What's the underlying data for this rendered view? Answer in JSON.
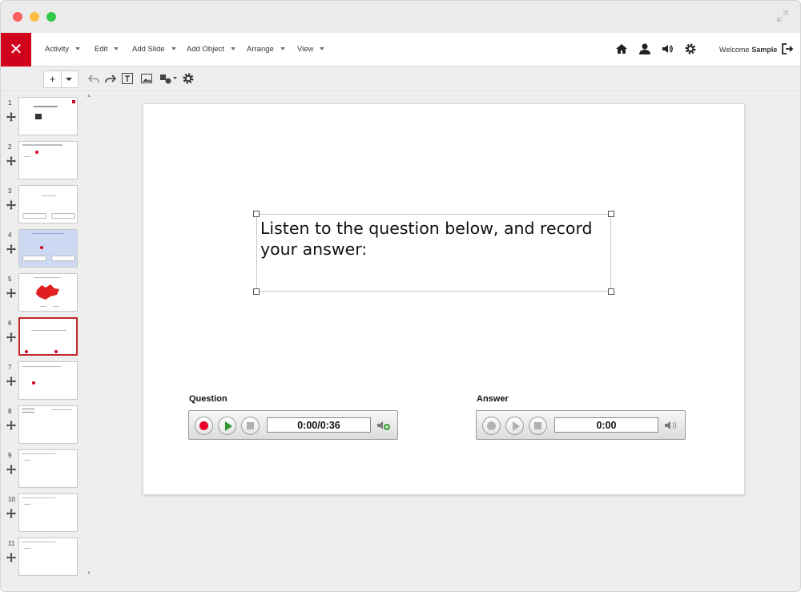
{
  "menubar": {
    "close_glyph": "✕",
    "items": [
      {
        "label": "Activity"
      },
      {
        "label": "Edit"
      },
      {
        "label": "Add Slide"
      },
      {
        "label": "Add Object"
      },
      {
        "label": "Arrange"
      },
      {
        "label": "View"
      }
    ],
    "welcome_prefix": "Welcome",
    "welcome_user": "Sample"
  },
  "toolbar": {
    "add_glyph": "+"
  },
  "slides": [
    {
      "number": "1"
    },
    {
      "number": "2"
    },
    {
      "number": "3"
    },
    {
      "number": "4"
    },
    {
      "number": "5"
    },
    {
      "number": "6"
    },
    {
      "number": "7"
    },
    {
      "number": "8"
    },
    {
      "number": "9"
    },
    {
      "number": "10"
    },
    {
      "number": "11"
    }
  ],
  "selected_slide": "6",
  "canvas": {
    "text": "Listen to the question below, and record your answer:",
    "question": {
      "label": "Question",
      "time": "0:00/0:36"
    },
    "answer": {
      "label": "Answer",
      "time": "0:00"
    }
  },
  "colors": {
    "accent": "#d0021b",
    "play": "#2c9a2c",
    "record": "#e8002a"
  }
}
